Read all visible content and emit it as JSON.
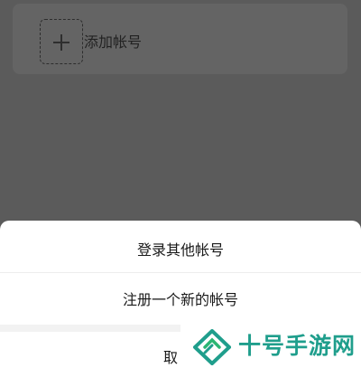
{
  "account_list": {
    "add_account_label": "添加帐号"
  },
  "action_sheet": {
    "login_other_label": "登录其他帐号",
    "register_new_label": "注册一个新的帐号",
    "cancel_label": "取"
  },
  "watermark": {
    "text": "十号手游网",
    "color": "#1f9e8c"
  }
}
